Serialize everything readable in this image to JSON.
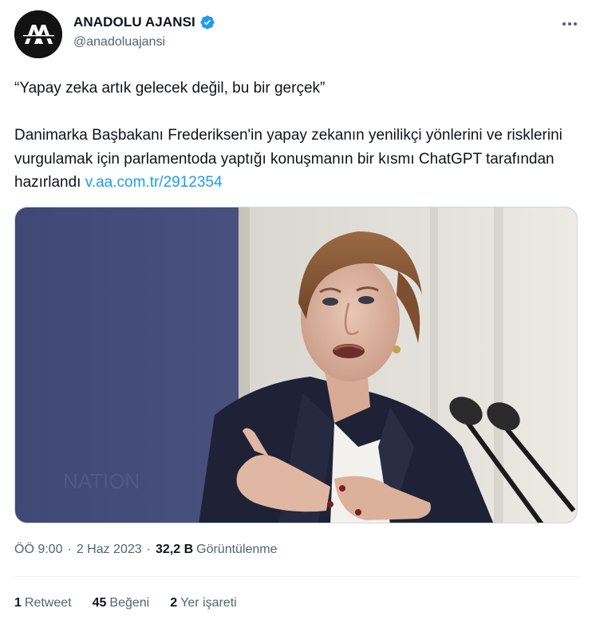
{
  "account": {
    "display_name": "ANADOLU AJANSI",
    "handle": "@anadoluajansi",
    "verified": true,
    "avatar_logo_text": "AA"
  },
  "tweet": {
    "line1": "“Yapay zeka artık gelecek değil, bu bir gerçek”",
    "body": "Danimarka Başbakanı Frederiksen'in yapay zekanın yenilikçi yönlerini ve risklerini vurgulamak için parlamentoda yaptığı konuşmanın bir kısmı ChatGPT tarafından hazırlandı ",
    "link": "v.aa.com.tr/2912354"
  },
  "meta": {
    "time": "ÖÖ 9:00",
    "date": "2 Haz 2023",
    "separator": "·",
    "views_count": "32,2 B",
    "views_label": "Görüntülenme"
  },
  "stats": {
    "retweets_count": "1",
    "retweets_label": "Retweet",
    "likes_count": "45",
    "likes_label": "Beğeni",
    "bookmarks_count": "2",
    "bookmarks_label": "Yer işareti"
  },
  "colors": {
    "link": "#1d9bf0",
    "verified": "#1d9bf0",
    "secondary_text": "#536471"
  },
  "icons": [
    "verified-badge-icon",
    "more-options-icon"
  ]
}
